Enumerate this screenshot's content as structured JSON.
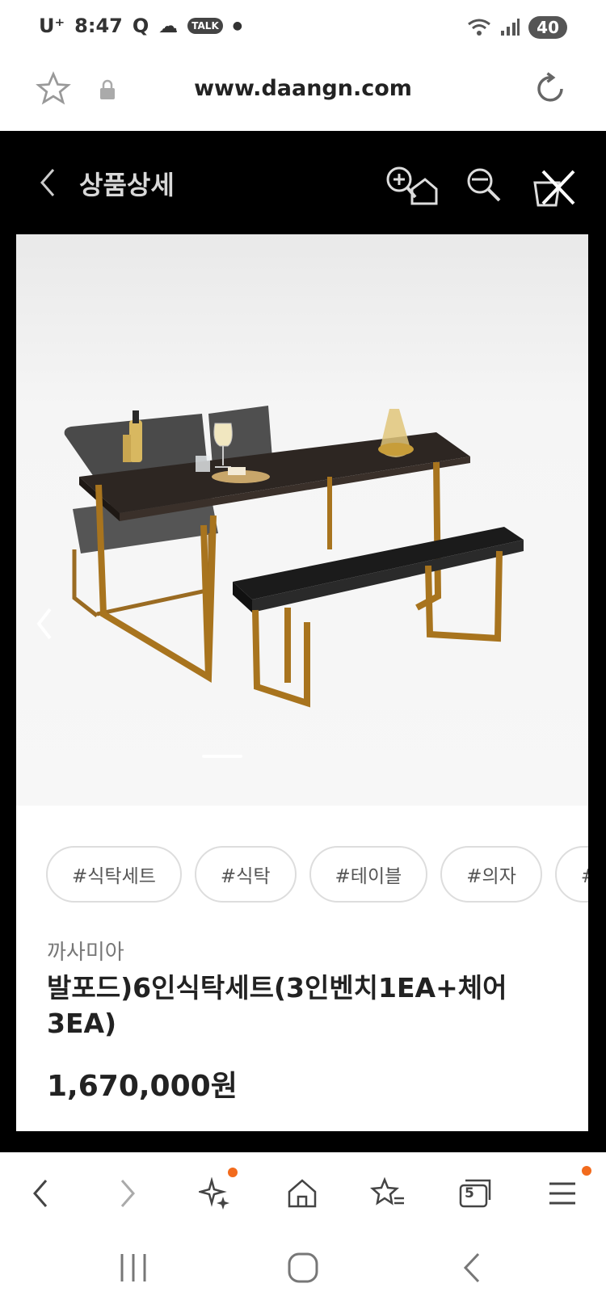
{
  "status_bar": {
    "carrier": "U⁺",
    "time": "8:47",
    "battery": "40"
  },
  "browser": {
    "url": "www.daangn.com"
  },
  "header": {
    "title": "상품상세"
  },
  "product": {
    "tags": [
      "#식탁세트",
      "#식탁",
      "#테이블",
      "#의자",
      "#체"
    ],
    "seller": "까사미아",
    "name": "발포드)6인식탁세트(3인벤치1EA+체어3EA)",
    "price": "1,670,000원"
  },
  "bottom_nav": {
    "tabs_count": "5"
  },
  "colors": {
    "accent": "#f26b1d",
    "frame": "#000000"
  }
}
